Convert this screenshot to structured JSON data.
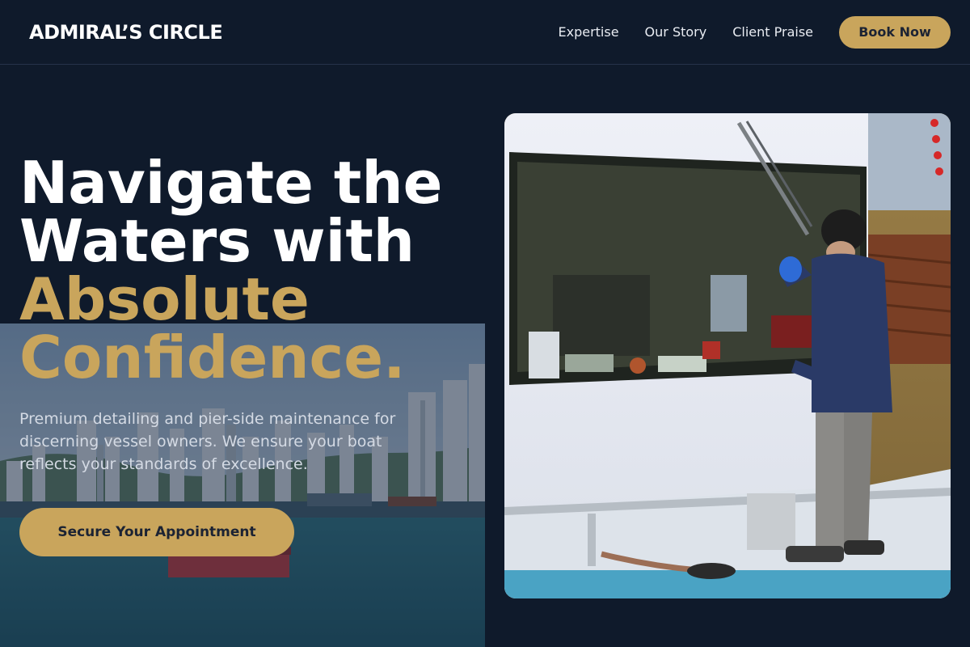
{
  "brand": "ADMIRAL’S CIRCLE",
  "nav": {
    "links": [
      "Expertise",
      "Our Story",
      "Client Praise"
    ],
    "book_label": "Book Now"
  },
  "hero": {
    "line1": "Navigate the",
    "line2": "Waters with",
    "line3": "Absolute",
    "line4": "Confidence.",
    "subtitle": "Premium detailing and pier-side maintenance for discerning vessel owners. We ensure your boat reflects your standards of excellence.",
    "cta_label": "Secure Your Appointment"
  },
  "images": {
    "harbor_alt": "harbor skyline",
    "boat_alt": "worker cleaning boat window"
  },
  "colors": {
    "background": "#0f1a2b",
    "accent": "#c9a55c",
    "text": "#ffffff"
  }
}
